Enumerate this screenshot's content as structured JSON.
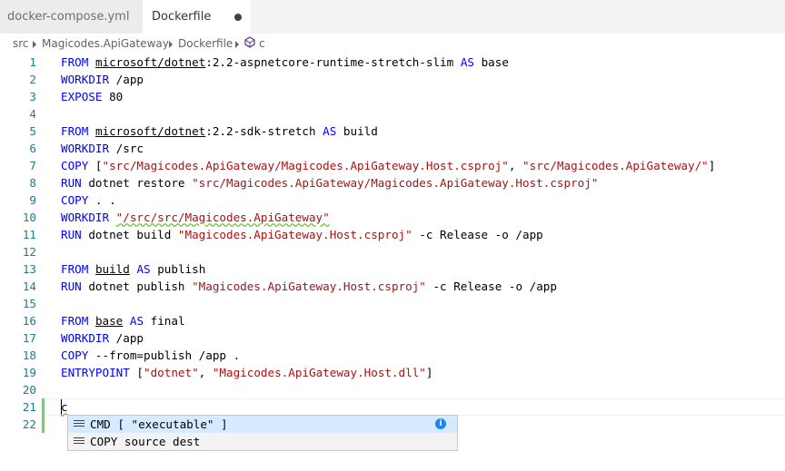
{
  "tabs": [
    {
      "label": "docker-compose.yml",
      "active": false
    },
    {
      "label": "Dockerfile",
      "active": true,
      "dirty": true
    }
  ],
  "breadcrumb": [
    "src",
    "Magicodes.ApiGateway",
    "Dockerfile",
    "c"
  ],
  "lines": [
    {
      "n": "1",
      "tokens": [
        [
          "FROM",
          "kw"
        ],
        [
          " ",
          ""
        ],
        [
          "microsoft/dotnet",
          "ul"
        ],
        [
          ":2.2-aspnetcore-runtime-stretch-slim ",
          ""
        ],
        [
          "AS",
          "kw"
        ],
        [
          " base",
          ""
        ]
      ]
    },
    {
      "n": "2",
      "tokens": [
        [
          "WORKDIR",
          "kw"
        ],
        [
          " /app",
          ""
        ]
      ]
    },
    {
      "n": "3",
      "tokens": [
        [
          "EXPOSE",
          "kw"
        ],
        [
          " 80",
          ""
        ]
      ]
    },
    {
      "n": "4",
      "tokens": []
    },
    {
      "n": "5",
      "tokens": [
        [
          "FROM",
          "kw"
        ],
        [
          " ",
          ""
        ],
        [
          "microsoft/dotnet",
          "ul"
        ],
        [
          ":2.2-sdk-stretch ",
          ""
        ],
        [
          "AS",
          "kw"
        ],
        [
          " build",
          ""
        ]
      ]
    },
    {
      "n": "6",
      "tokens": [
        [
          "WORKDIR",
          "kw"
        ],
        [
          " /src",
          ""
        ]
      ]
    },
    {
      "n": "7",
      "tokens": [
        [
          "COPY",
          "kw"
        ],
        [
          " [",
          ""
        ],
        [
          "\"src/Magicodes.ApiGateway/Magicodes.ApiGateway.Host.csproj\"",
          "str"
        ],
        [
          ", ",
          ""
        ],
        [
          "\"src/Magicodes.ApiGateway/\"",
          "str"
        ],
        [
          "]",
          ""
        ]
      ]
    },
    {
      "n": "8",
      "tokens": [
        [
          "RUN",
          "kw"
        ],
        [
          " dotnet restore ",
          ""
        ],
        [
          "\"src/Magicodes.ApiGateway/Magicodes.ApiGateway.Host.csproj\"",
          "str"
        ]
      ]
    },
    {
      "n": "9",
      "tokens": [
        [
          "COPY",
          "kw"
        ],
        [
          " . .",
          ""
        ]
      ]
    },
    {
      "n": "10",
      "tokens": [
        [
          "WORKDIR",
          "kw"
        ],
        [
          " ",
          ""
        ],
        [
          "\"/src/src/Magicodes.ApiGateway\"",
          "str squig"
        ]
      ]
    },
    {
      "n": "11",
      "tokens": [
        [
          "RUN",
          "kw"
        ],
        [
          " dotnet build ",
          ""
        ],
        [
          "\"Magicodes.ApiGateway.Host.csproj\"",
          "str"
        ],
        [
          " -c Release -o /app",
          ""
        ]
      ]
    },
    {
      "n": "12",
      "tokens": []
    },
    {
      "n": "13",
      "tokens": [
        [
          "FROM",
          "kw"
        ],
        [
          " ",
          ""
        ],
        [
          "build",
          "ul"
        ],
        [
          " ",
          ""
        ],
        [
          "AS",
          "kw"
        ],
        [
          " publish",
          ""
        ]
      ]
    },
    {
      "n": "14",
      "tokens": [
        [
          "RUN",
          "kw"
        ],
        [
          " dotnet publish ",
          ""
        ],
        [
          "\"Magicodes.ApiGateway.Host.csproj\"",
          "str"
        ],
        [
          " -c Release -o /app",
          ""
        ]
      ]
    },
    {
      "n": "15",
      "tokens": []
    },
    {
      "n": "16",
      "tokens": [
        [
          "FROM",
          "kw"
        ],
        [
          " ",
          ""
        ],
        [
          "base",
          "ul"
        ],
        [
          " ",
          ""
        ],
        [
          "AS",
          "kw"
        ],
        [
          " final",
          ""
        ]
      ]
    },
    {
      "n": "17",
      "tokens": [
        [
          "WORKDIR",
          "kw"
        ],
        [
          " /app",
          ""
        ]
      ]
    },
    {
      "n": "18",
      "tokens": [
        [
          "COPY",
          "kw"
        ],
        [
          " --from=publish /app .",
          ""
        ]
      ]
    },
    {
      "n": "19",
      "tokens": [
        [
          "ENTRYPOINT",
          "kw"
        ],
        [
          " [",
          ""
        ],
        [
          "\"dotnet\"",
          "str"
        ],
        [
          ", ",
          ""
        ],
        [
          "\"Magicodes.ApiGateway.Host.dll\"",
          "str"
        ],
        [
          "]",
          ""
        ]
      ]
    },
    {
      "n": "20",
      "tokens": []
    },
    {
      "n": "21",
      "tokens": [
        [
          "c",
          "squig"
        ]
      ]
    },
    {
      "n": "22",
      "tokens": []
    }
  ],
  "suggestions": [
    {
      "label": "CMD [ \"executable\" ]",
      "selected": true
    },
    {
      "label": "COPY source dest",
      "selected": false
    }
  ],
  "colors": {
    "keyword": "#0000ff",
    "string": "#a31515",
    "line_number": "#237893",
    "selection": "#d6ebff"
  }
}
